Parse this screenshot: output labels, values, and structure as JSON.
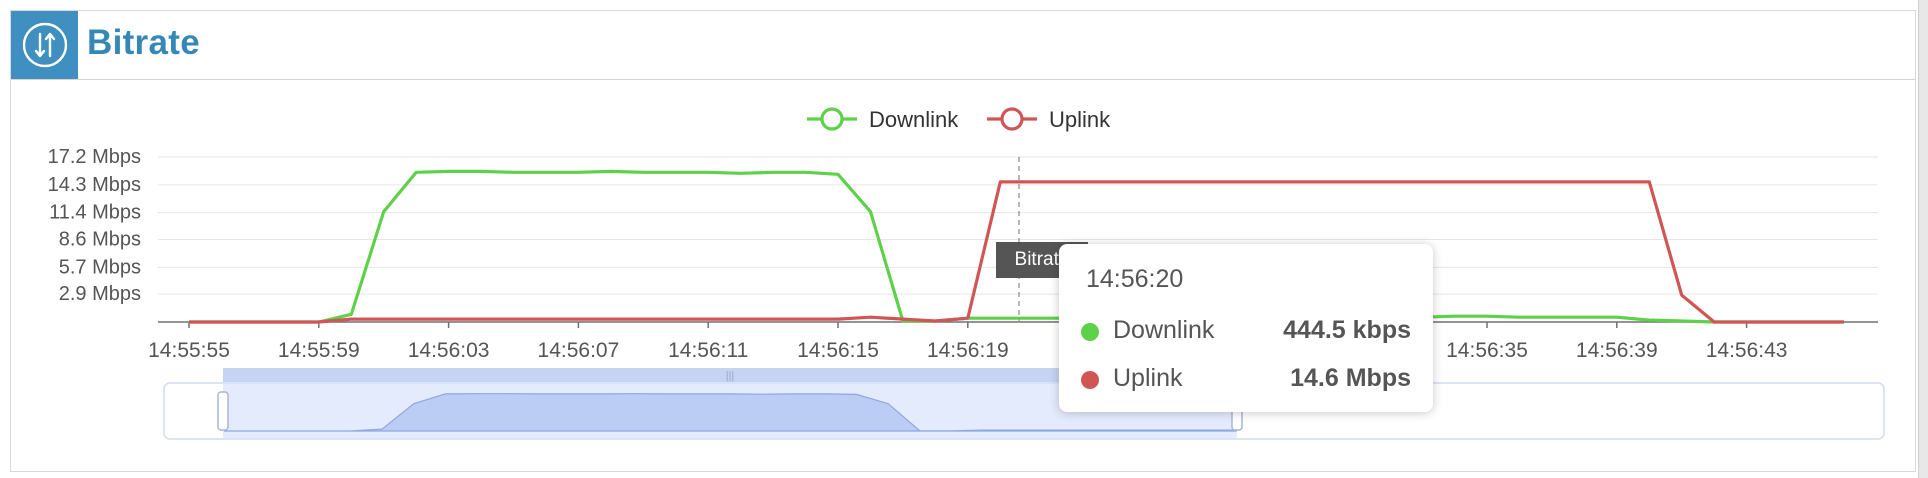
{
  "header": {
    "title": "Bitrate",
    "icon": "up-down-arrows-icon"
  },
  "colors": {
    "downlink": "#5ed14a",
    "uplink": "#d05656",
    "header_bg": "#3f8fc0",
    "title": "#3588b6"
  },
  "chart_data": {
    "type": "line",
    "title": "",
    "xlabel": "",
    "ylabel": "",
    "y_unit": "Mbps",
    "ylim": [
      0,
      17.2
    ],
    "y_ticks": [
      2.9,
      5.7,
      8.6,
      11.4,
      14.3,
      17.2
    ],
    "y_tick_labels": [
      "2.9 Mbps",
      "5.7 Mbps",
      "8.6 Mbps",
      "11.4 Mbps",
      "14.3 Mbps",
      "17.2 Mbps"
    ],
    "x_tick_labels": [
      "14:55:55",
      "14:55:59",
      "14:56:03",
      "14:56:07",
      "14:56:11",
      "14:56:15",
      "14:56:19",
      "14:56:35",
      "14:56:39",
      "14:56:43"
    ],
    "x": [
      "14:55:55",
      "14:55:56",
      "14:55:57",
      "14:55:58",
      "14:55:59",
      "14:56:00",
      "14:56:01",
      "14:56:02",
      "14:56:03",
      "14:56:04",
      "14:56:05",
      "14:56:06",
      "14:56:07",
      "14:56:08",
      "14:56:09",
      "14:56:10",
      "14:56:11",
      "14:56:12",
      "14:56:13",
      "14:56:14",
      "14:56:15",
      "14:56:16",
      "14:56:17",
      "14:56:18",
      "14:56:19",
      "14:56:20",
      "14:56:21",
      "14:56:22",
      "14:56:23",
      "14:56:24",
      "14:56:25",
      "14:56:26",
      "14:56:27",
      "14:56:28",
      "14:56:29",
      "14:56:30",
      "14:56:31",
      "14:56:32",
      "14:56:33",
      "14:56:34",
      "14:56:35",
      "14:56:36",
      "14:56:37",
      "14:56:38",
      "14:56:39",
      "14:56:40",
      "14:56:41",
      "14:56:42",
      "14:56:43",
      "14:56:44",
      "14:56:45",
      "14:56:46"
    ],
    "legend_position": "top-center",
    "grid": true,
    "series": [
      {
        "name": "Downlink",
        "values": [
          0,
          0,
          0,
          0,
          0,
          0.8,
          11.5,
          15.6,
          15.7,
          15.7,
          15.6,
          15.6,
          15.6,
          15.7,
          15.6,
          15.6,
          15.6,
          15.5,
          15.6,
          15.6,
          15.4,
          11.5,
          0.1,
          0.1,
          0.4,
          0.4,
          0.4,
          0.4,
          0.4,
          0.4,
          0.4,
          0.4,
          0.4,
          0.4,
          0.4,
          0.4,
          0.4,
          0.4,
          0.5,
          0.6,
          0.6,
          0.5,
          0.5,
          0.5,
          0.5,
          0.2,
          0.1,
          0,
          0,
          0,
          0,
          0
        ]
      },
      {
        "name": "Uplink",
        "values": [
          0,
          0,
          0,
          0,
          0,
          0.3,
          0.3,
          0.3,
          0.3,
          0.3,
          0.3,
          0.3,
          0.3,
          0.3,
          0.3,
          0.3,
          0.3,
          0.3,
          0.3,
          0.3,
          0.3,
          0.5,
          0.3,
          0.1,
          0.4,
          14.6,
          14.6,
          14.6,
          14.6,
          14.6,
          14.6,
          14.6,
          14.6,
          14.6,
          14.6,
          14.6,
          14.6,
          14.6,
          14.6,
          14.6,
          14.6,
          14.6,
          14.6,
          14.6,
          14.6,
          14.6,
          2.8,
          0,
          0,
          0,
          0,
          0
        ]
      }
    ],
    "overview_values": [
      0,
      0,
      0,
      0,
      0,
      0.8,
      11.5,
      15.6,
      15.7,
      15.7,
      15.6,
      15.6,
      15.6,
      15.7,
      15.6,
      15.6,
      15.6,
      15.5,
      15.6,
      15.6,
      15.4,
      11.5,
      0.1,
      0.1,
      0.4,
      0.4,
      0.4,
      0.4,
      0.4,
      0.4,
      0.4,
      0.4,
      0.4
    ]
  },
  "tooltip": {
    "badge": "Bitrate",
    "time": "14:56:20",
    "rows": [
      {
        "name": "Downlink",
        "value": "444.5 kbps"
      },
      {
        "name": "Uplink",
        "value": "14.6 Mbps"
      }
    ]
  },
  "zoom": {
    "handle_grip": "|||"
  }
}
